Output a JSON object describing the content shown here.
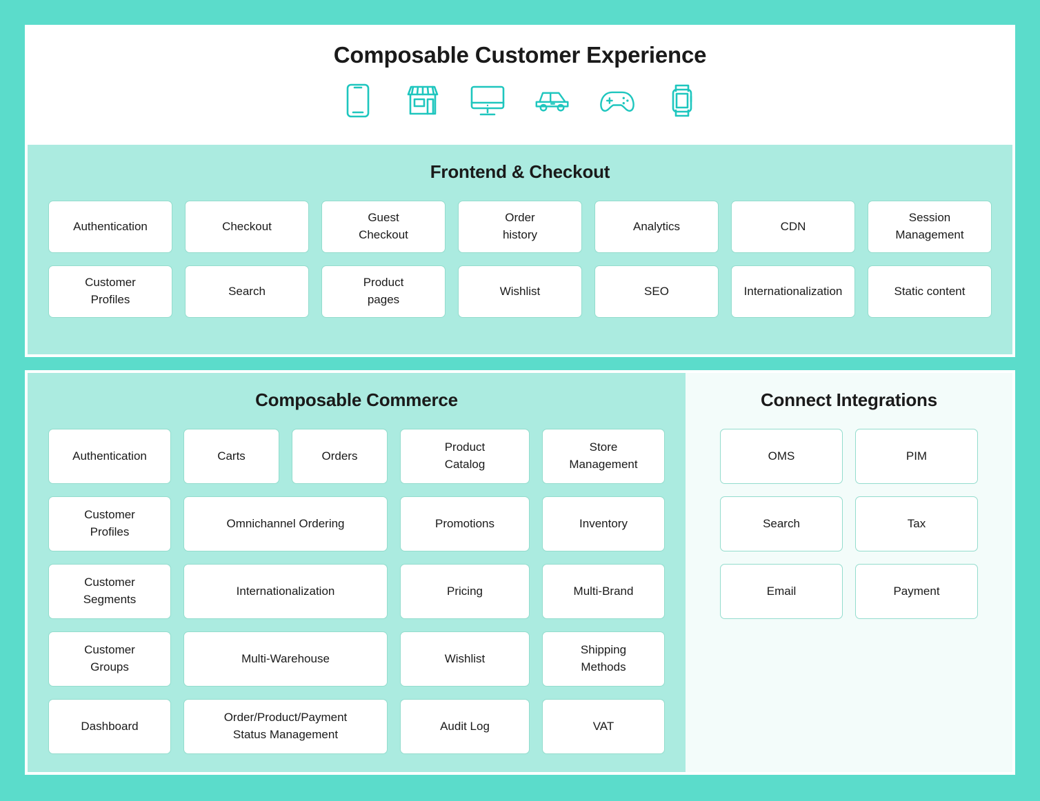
{
  "colors": {
    "outer_background": "#5BDCCB",
    "header_background": "#FFFFFF",
    "section_background": "#ABEBE0",
    "integrations_background": "#F3FCFA",
    "card_background": "#FFFFFF",
    "card_border": "#93DCCD",
    "icon_accent": "#1EC6BE",
    "text": "#1A1A1A"
  },
  "header": {
    "title": "Composable Customer Experience",
    "icons": [
      {
        "name": "mobile-phone-icon",
        "label": "Mobile"
      },
      {
        "name": "storefront-icon",
        "label": "Store"
      },
      {
        "name": "desktop-monitor-icon",
        "label": "Desktop"
      },
      {
        "name": "car-icon",
        "label": "Car"
      },
      {
        "name": "game-controller-icon",
        "label": "Gaming"
      },
      {
        "name": "smartwatch-icon",
        "label": "Wearable"
      }
    ]
  },
  "frontend": {
    "title": "Frontend & Checkout",
    "row1": [
      "Authentication",
      "Checkout",
      "Guest\nCheckout",
      "Order\nhistory",
      "Analytics",
      "CDN",
      "Session\nManagement"
    ],
    "row2": [
      "Customer\nProfiles",
      "Search",
      "Product\npages",
      "Wishlist",
      "SEO",
      "Internationalization",
      "Static content"
    ]
  },
  "commerce": {
    "title": "Composable Commerce",
    "row1": [
      "Authentication",
      "Carts",
      "Orders",
      "Product\nCatalog",
      "Store\nManagement"
    ],
    "row2": [
      "Customer\nProfiles",
      "Omnichannel Ordering",
      "Promotions",
      "Inventory"
    ],
    "row3": [
      "Customer\nSegments",
      "Internationalization",
      "Pricing",
      "Multi-Brand"
    ],
    "row4": [
      "Customer\nGroups",
      "Multi-Warehouse",
      "Wishlist",
      "Shipping\nMethods"
    ],
    "row5": [
      "Dashboard",
      "Order/Product/Payment\nStatus Management",
      "Audit Log",
      "VAT"
    ]
  },
  "integrations": {
    "title": "Connect Integrations",
    "items": [
      "OMS",
      "PIM",
      "Search",
      "Tax",
      "Email",
      "Payment"
    ]
  }
}
